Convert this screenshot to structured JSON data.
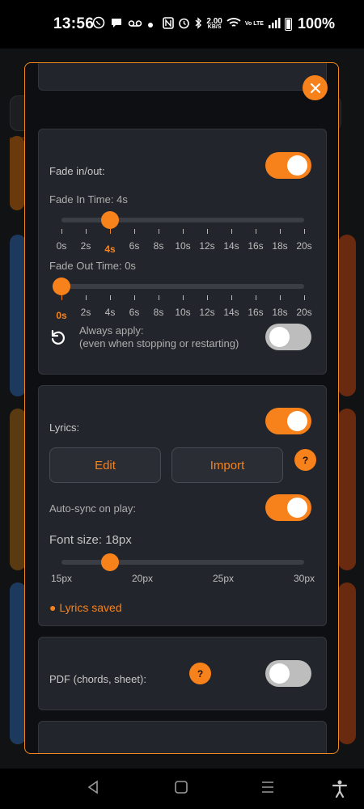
{
  "status_bar": {
    "time": "13:56",
    "left_icons": [
      "whatsapp-icon",
      "chat-icon",
      "voicemail-icon",
      "dot-icon"
    ],
    "speed_value": "2.00",
    "speed_unit": "KB/S",
    "network_label": "Vo LTE",
    "battery": "100%"
  },
  "modal": {
    "fade": {
      "label": "Fade in/out:",
      "enabled": true,
      "fade_in_label": "Fade In Time: 4s",
      "fade_in_value": 4,
      "fade_out_label": "Fade Out Time: 0s",
      "fade_out_value": 0,
      "ticks": [
        "0s",
        "2s",
        "4s",
        "6s",
        "8s",
        "10s",
        "12s",
        "14s",
        "16s",
        "18s",
        "20s"
      ],
      "always_apply_line1": "Always apply:",
      "always_apply_line2": "(even when stopping or restarting)",
      "always_apply_enabled": false
    },
    "lyrics": {
      "label": "Lyrics:",
      "enabled": true,
      "edit_label": "Edit",
      "import_label": "Import",
      "help": "?",
      "autosync_label": "Auto-sync on play:",
      "autosync_enabled": true,
      "font_size_label": "Font size: 18px",
      "font_size_value": 18,
      "font_ticks": [
        "15px",
        "20px",
        "25px",
        "30px"
      ],
      "saved_status": "● Lyrics saved"
    },
    "pdf": {
      "label": "PDF (chords, sheet):",
      "help": "?",
      "enabled": false
    }
  },
  "colors": {
    "accent": "#f7821b",
    "card_bg": "#23252c",
    "modal_border": "#f28a1d"
  }
}
